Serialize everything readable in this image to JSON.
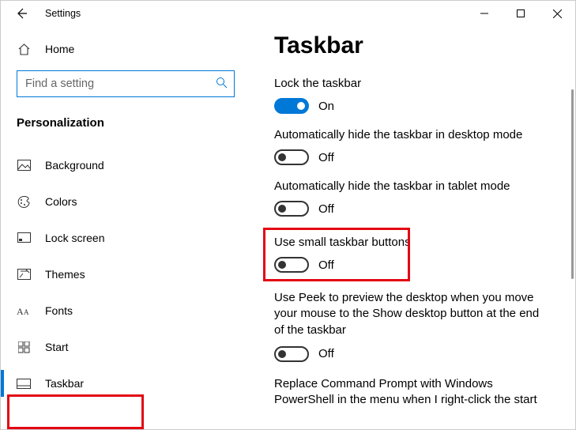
{
  "window": {
    "title": "Settings"
  },
  "sidebar": {
    "home_label": "Home",
    "search_placeholder": "Find a setting",
    "group_label": "Personalization",
    "items": [
      {
        "label": "Background"
      },
      {
        "label": "Colors"
      },
      {
        "label": "Lock screen"
      },
      {
        "label": "Themes"
      },
      {
        "label": "Fonts"
      },
      {
        "label": "Start"
      },
      {
        "label": "Taskbar"
      }
    ]
  },
  "page": {
    "title": "Taskbar",
    "settings": [
      {
        "label": "Lock the taskbar",
        "on": true,
        "state": "On"
      },
      {
        "label": "Automatically hide the taskbar in desktop mode",
        "on": false,
        "state": "Off"
      },
      {
        "label": "Automatically hide the taskbar in tablet mode",
        "on": false,
        "state": "Off"
      },
      {
        "label": "Use small taskbar buttons",
        "on": false,
        "state": "Off"
      },
      {
        "label": "Use Peek to preview the desktop when you move your mouse to the Show desktop button at the end of the taskbar",
        "on": false,
        "state": "Off"
      },
      {
        "label": "Replace Command Prompt with Windows PowerShell in the menu when I right-click the start"
      }
    ]
  }
}
